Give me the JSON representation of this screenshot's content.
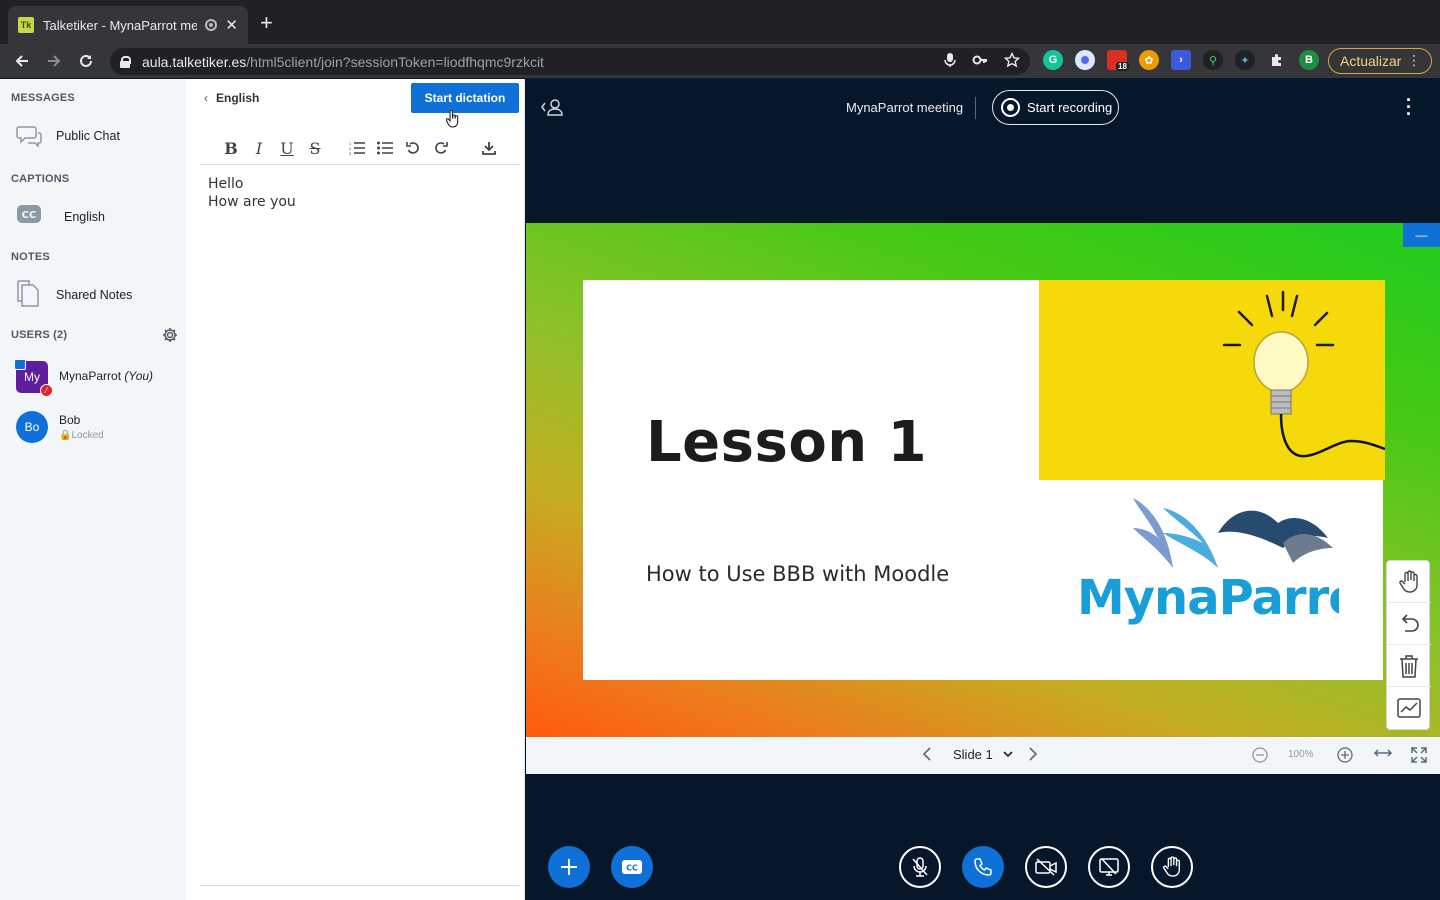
{
  "browser": {
    "tab_title": "Talketiker - MynaParrot me",
    "favicon_text": "Tk",
    "url_host": "aula.talketiker.es",
    "url_path": "/html5client/join?sessionToken=liodfhqmc9rzkcit",
    "profile_initial": "B",
    "ext_badge": "18",
    "update_label": "Actualizar"
  },
  "sidebar": {
    "messages_title": "MESSAGES",
    "public_chat": "Public Chat",
    "captions_title": "CAPTIONS",
    "captions_item": "English",
    "notes_title": "NOTES",
    "shared_notes": "Shared Notes",
    "users_title": "USERS (2)",
    "users": [
      {
        "initials": "My",
        "name": "MynaParrot",
        "you": "(You)",
        "sub": ""
      },
      {
        "initials": "Bo",
        "name": "Bob",
        "you": "",
        "sub": "Locked"
      }
    ]
  },
  "captions_pad": {
    "back_label": "English",
    "dictation_label": "Start dictation",
    "lines": [
      "Hello",
      "How are you"
    ]
  },
  "meeting": {
    "name": "MynaParrot meeting",
    "record_label": "Start recording"
  },
  "slide": {
    "title": "Lesson 1",
    "subtitle": "How to Use BBB with Moodle",
    "logo_text": "MynaParrot",
    "minimize_label": "—"
  },
  "slide_controls": {
    "slide_label": "Slide 1",
    "zoom": "100%"
  },
  "colors": {
    "accent": "#0f70d7",
    "background": "#06172a",
    "sidebar": "#f3f6f9"
  }
}
